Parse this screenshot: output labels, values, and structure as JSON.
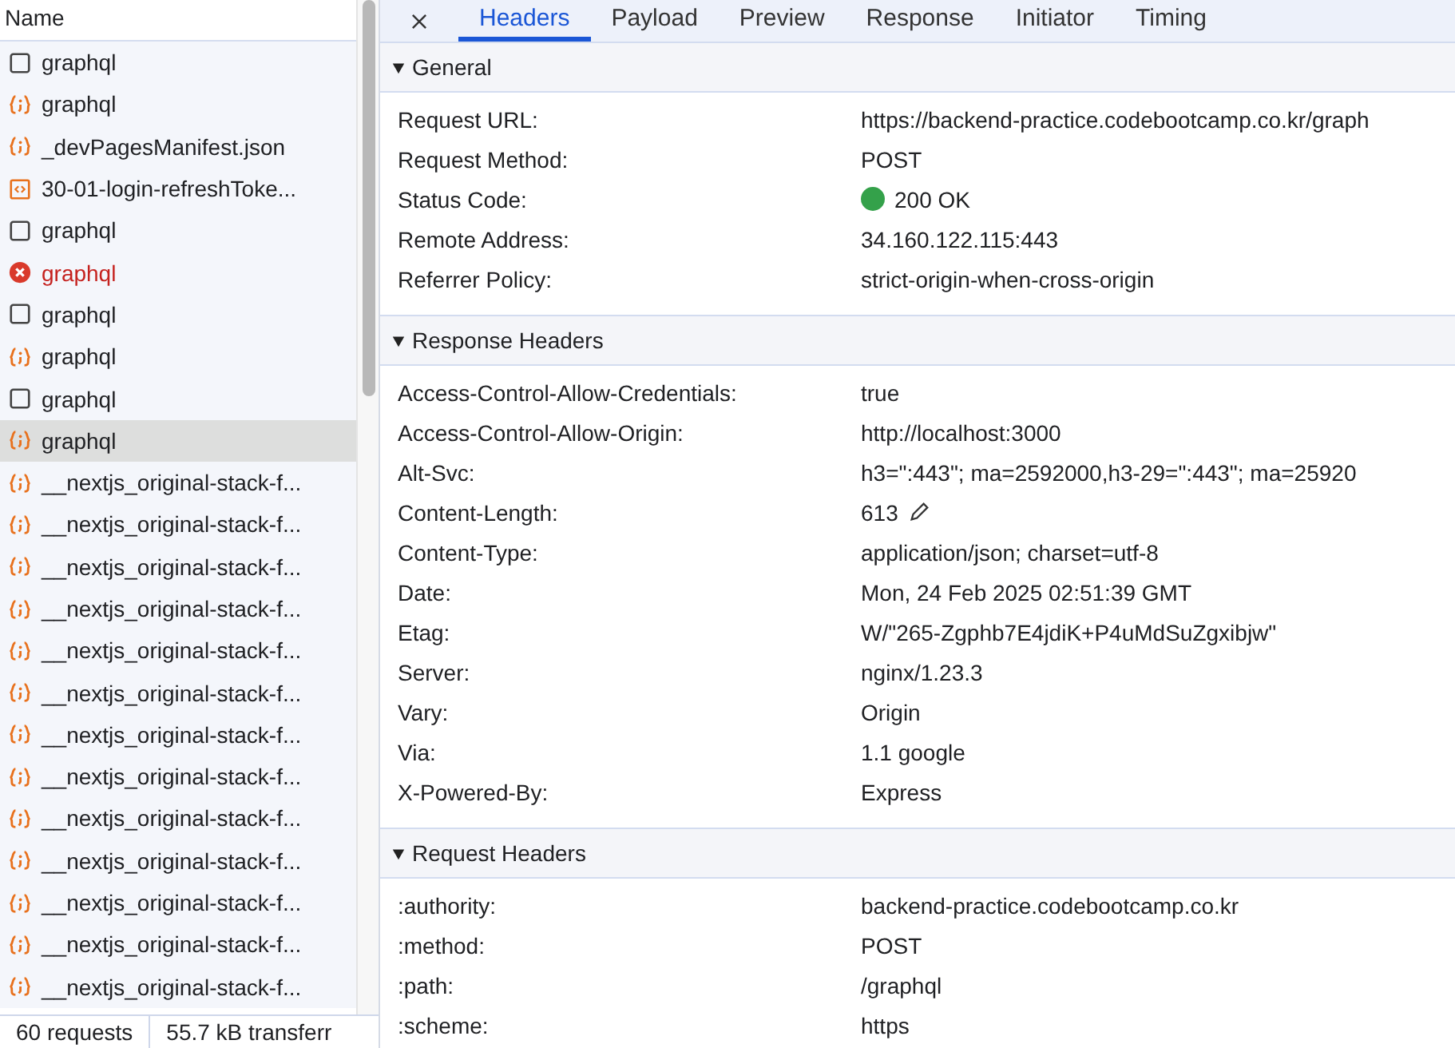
{
  "requests": {
    "column": "Name",
    "rows": [
      {
        "name": "graphql",
        "kind": "document",
        "selected": false,
        "error": false
      },
      {
        "name": "graphql",
        "kind": "fetch",
        "selected": false,
        "error": false
      },
      {
        "name": "_devPagesManifest.json",
        "kind": "fetch",
        "selected": false,
        "error": false
      },
      {
        "name": "30-01-login-refreshToke...",
        "kind": "script",
        "selected": false,
        "error": false
      },
      {
        "name": "graphql",
        "kind": "document",
        "selected": false,
        "error": false
      },
      {
        "name": "graphql",
        "kind": "error",
        "selected": false,
        "error": true
      },
      {
        "name": "graphql",
        "kind": "document",
        "selected": false,
        "error": false
      },
      {
        "name": "graphql",
        "kind": "fetch",
        "selected": false,
        "error": false
      },
      {
        "name": "graphql",
        "kind": "document",
        "selected": false,
        "error": false
      },
      {
        "name": "graphql",
        "kind": "fetch",
        "selected": true,
        "error": false
      },
      {
        "name": "__nextjs_original-stack-f...",
        "kind": "fetch",
        "selected": false,
        "error": false
      },
      {
        "name": "__nextjs_original-stack-f...",
        "kind": "fetch",
        "selected": false,
        "error": false
      },
      {
        "name": "__nextjs_original-stack-f...",
        "kind": "fetch",
        "selected": false,
        "error": false
      },
      {
        "name": "__nextjs_original-stack-f...",
        "kind": "fetch",
        "selected": false,
        "error": false
      },
      {
        "name": "__nextjs_original-stack-f...",
        "kind": "fetch",
        "selected": false,
        "error": false
      },
      {
        "name": "__nextjs_original-stack-f...",
        "kind": "fetch",
        "selected": false,
        "error": false
      },
      {
        "name": "__nextjs_original-stack-f...",
        "kind": "fetch",
        "selected": false,
        "error": false
      },
      {
        "name": "__nextjs_original-stack-f...",
        "kind": "fetch",
        "selected": false,
        "error": false
      },
      {
        "name": "__nextjs_original-stack-f...",
        "kind": "fetch",
        "selected": false,
        "error": false
      },
      {
        "name": "__nextjs_original-stack-f...",
        "kind": "fetch",
        "selected": false,
        "error": false
      },
      {
        "name": "__nextjs_original-stack-f...",
        "kind": "fetch",
        "selected": false,
        "error": false
      },
      {
        "name": "__nextjs_original-stack-f...",
        "kind": "fetch",
        "selected": false,
        "error": false
      },
      {
        "name": "__nextjs_original-stack-f...",
        "kind": "fetch",
        "selected": false,
        "error": false
      }
    ]
  },
  "status_bar": [
    "60 requests",
    "55.7 kB transferr"
  ],
  "tabs": [
    {
      "label": "Headers",
      "selected": true
    },
    {
      "label": "Payload",
      "selected": false
    },
    {
      "label": "Preview",
      "selected": false
    },
    {
      "label": "Response",
      "selected": false
    },
    {
      "label": "Initiator",
      "selected": false
    },
    {
      "label": "Timing",
      "selected": false
    }
  ],
  "sections": [
    {
      "title": "General",
      "expanded": true,
      "rows": [
        {
          "key": "Request URL:",
          "value": "https://backend-practice.codebootcamp.co.kr/graph"
        },
        {
          "key": "Request Method:",
          "value": "POST"
        },
        {
          "key": "Status Code:",
          "value": "200 OK",
          "success": true
        },
        {
          "key": "Remote Address:",
          "value": "34.160.122.115:443"
        },
        {
          "key": "Referrer Policy:",
          "value": "strict-origin-when-cross-origin"
        }
      ]
    },
    {
      "title": "Response Headers",
      "expanded": true,
      "rows": [
        {
          "key": "Access-Control-Allow-Credentials:",
          "value": "true"
        },
        {
          "key": "Access-Control-Allow-Origin:",
          "value": "http://localhost:3000"
        },
        {
          "key": "Alt-Svc:",
          "value": "h3=\":443\"; ma=2592000,h3-29=\":443\"; ma=25920"
        },
        {
          "key": "Content-Length:",
          "value": "613",
          "editable": true
        },
        {
          "key": "Content-Type:",
          "value": "application/json; charset=utf-8"
        },
        {
          "key": "Date:",
          "value": "Mon, 24 Feb 2025 02:51:39 GMT"
        },
        {
          "key": "Etag:",
          "value": "W/\"265-Zgphb7E4jdiK+P4uMdSuZgxibjw\""
        },
        {
          "key": "Server:",
          "value": "nginx/1.23.3"
        },
        {
          "key": "Vary:",
          "value": "Origin"
        },
        {
          "key": "Via:",
          "value": "1.1 google"
        },
        {
          "key": "X-Powered-By:",
          "value": "Express"
        }
      ]
    },
    {
      "title": "Request Headers",
      "expanded": true,
      "rows": [
        {
          "key": ":authority:",
          "value": "backend-practice.codebootcamp.co.kr"
        },
        {
          "key": ":method:",
          "value": "POST"
        },
        {
          "key": ":path:",
          "value": "/graphql"
        },
        {
          "key": ":scheme:",
          "value": "https"
        }
      ]
    }
  ]
}
